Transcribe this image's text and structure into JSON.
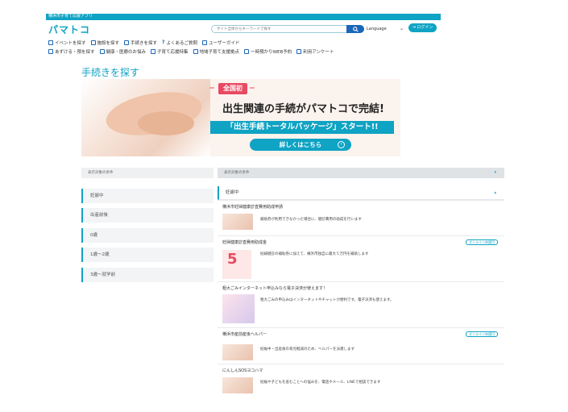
{
  "header": {
    "topbar_label": "横浜市子育て応援アプリ",
    "logo": "パマトコ",
    "search_placeholder": "サイト全体からキーワードで探す",
    "language_label": "Language",
    "login_label": "ログイン"
  },
  "nav_primary": [
    {
      "label": "イベントを探す",
      "icon": "calendar-icon"
    },
    {
      "label": "施設を探す",
      "icon": "building-icon"
    },
    {
      "label": "手続きを探す",
      "icon": "document-icon"
    },
    {
      "label": "よくあるご質問",
      "icon": "question-icon"
    },
    {
      "label": "ユーザーガイド",
      "icon": "guide-icon"
    }
  ],
  "nav_secondary": [
    {
      "label": "あずける・預を探す",
      "icon": "child-icon"
    },
    {
      "label": "健康・医療のお悩み",
      "icon": "health-icon"
    },
    {
      "label": "子育て応援特集",
      "icon": "thumbs-up-icon"
    },
    {
      "label": "地域子育て支援拠点",
      "icon": "building-icon"
    },
    {
      "label": "一時預かりWEB予約",
      "icon": "run-icon"
    },
    {
      "label": "利用アンケート",
      "icon": "survey-icon"
    }
  ],
  "page_title": "手続きを探す",
  "banner": {
    "badge": "全国初",
    "headline": "出生関連の手続がパマトコで完結!",
    "subline": "「出生手続トータルパッケージ」スタート!!",
    "button_label": "詳しくはこちら"
  },
  "filter": {
    "left_header": "表示対象の条件",
    "right_header": "表示対象の条件",
    "categories": [
      "妊娠中",
      "出産前後",
      "0歳",
      "1歳〜2歳",
      "3歳〜就学前"
    ],
    "selected": "妊娠中"
  },
  "results": [
    {
      "title": "横浜市妊婦健康診査費用助成申請",
      "desc": "補助券が利用できなかった場合に、健診費用の助成を行います",
      "badge": "",
      "thumb": "baby-photo"
    },
    {
      "title": "妊婦健康診査費用助成金",
      "desc": "妊婦健診の補助券に加えて、横浜市独自に最大５万円を補助します",
      "badge": "オンライン申請可",
      "thumb": "five-graphic",
      "thumb_text": "5"
    },
    {
      "title": "粗大ごみインターネット申込みなら電子決済が使えます！",
      "desc": "粗大ごみの申込みはインターネットやチャットが便利です。電子決済も使えます。",
      "badge": "",
      "thumb": "trash-graphic"
    },
    {
      "title": "横浜市産前産後ヘルパー",
      "desc": "妊娠中・出産後の育児軽減のため、ヘルパーを派遣します",
      "badge": "オンライン申請可",
      "thumb": "baby-photo"
    },
    {
      "title": "にんしんSOSヨコハマ",
      "desc": "妊娠や子どもを産むことへの悩みを、電話やメール、LINEで相談できます",
      "badge": "",
      "thumb": "baby-photo"
    }
  ],
  "colors": {
    "accent": "#0fa3c4",
    "brand_dark": "#1a66b8",
    "highlight": "#e84a63"
  }
}
